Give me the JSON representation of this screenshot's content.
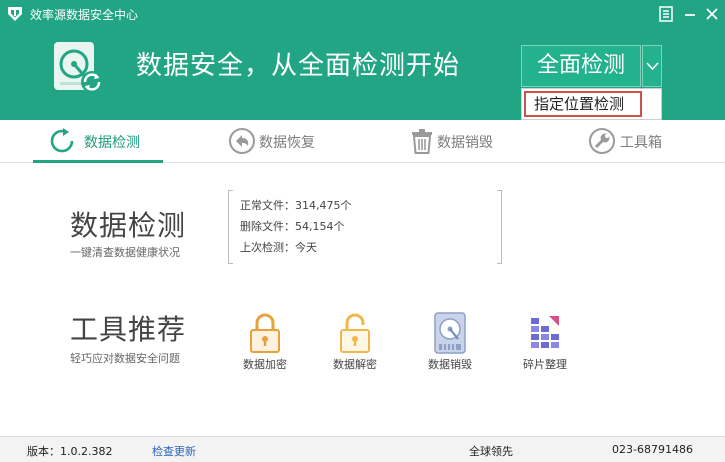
{
  "window": {
    "title": "效率源数据安全中心"
  },
  "header": {
    "headline": "数据安全，从全面检测开始",
    "scan_button": "全面检测",
    "scan_menu_item": "指定位置检测"
  },
  "tabs": [
    {
      "label": "数据检测",
      "icon": "refresh-ring-icon",
      "active": true
    },
    {
      "label": "数据恢复",
      "icon": "undo-arrow-icon",
      "active": false
    },
    {
      "label": "数据销毁",
      "icon": "trash-icon",
      "active": false
    },
    {
      "label": "工具箱",
      "icon": "wrench-icon",
      "active": false
    }
  ],
  "detection": {
    "title": "数据检测",
    "subtitle": "一键清查数据健康状况",
    "stats": [
      "正常文件：314,475个",
      "删除文件：54,154个",
      "上次检测：今天"
    ]
  },
  "tools": {
    "title": "工具推荐",
    "subtitle": "轻巧应对数据安全问题",
    "items": [
      {
        "label": "数据加密",
        "icon": "lock-closed-icon"
      },
      {
        "label": "数据解密",
        "icon": "lock-open-icon"
      },
      {
        "label": "数据销毁",
        "icon": "disk-shred-icon"
      },
      {
        "label": "碎片整理",
        "icon": "defrag-icon"
      }
    ]
  },
  "status": {
    "version": "版本：1.0.2.382",
    "update_link": "检查更新",
    "slogan": "全球领先",
    "phone": "023-68791486"
  },
  "colors": {
    "brand_green": "#21a584",
    "tab_active": "#1f9b7b",
    "menu_highlight": "#c9534a",
    "link": "#2a64c5",
    "lock_orange": "#e8a23c"
  }
}
